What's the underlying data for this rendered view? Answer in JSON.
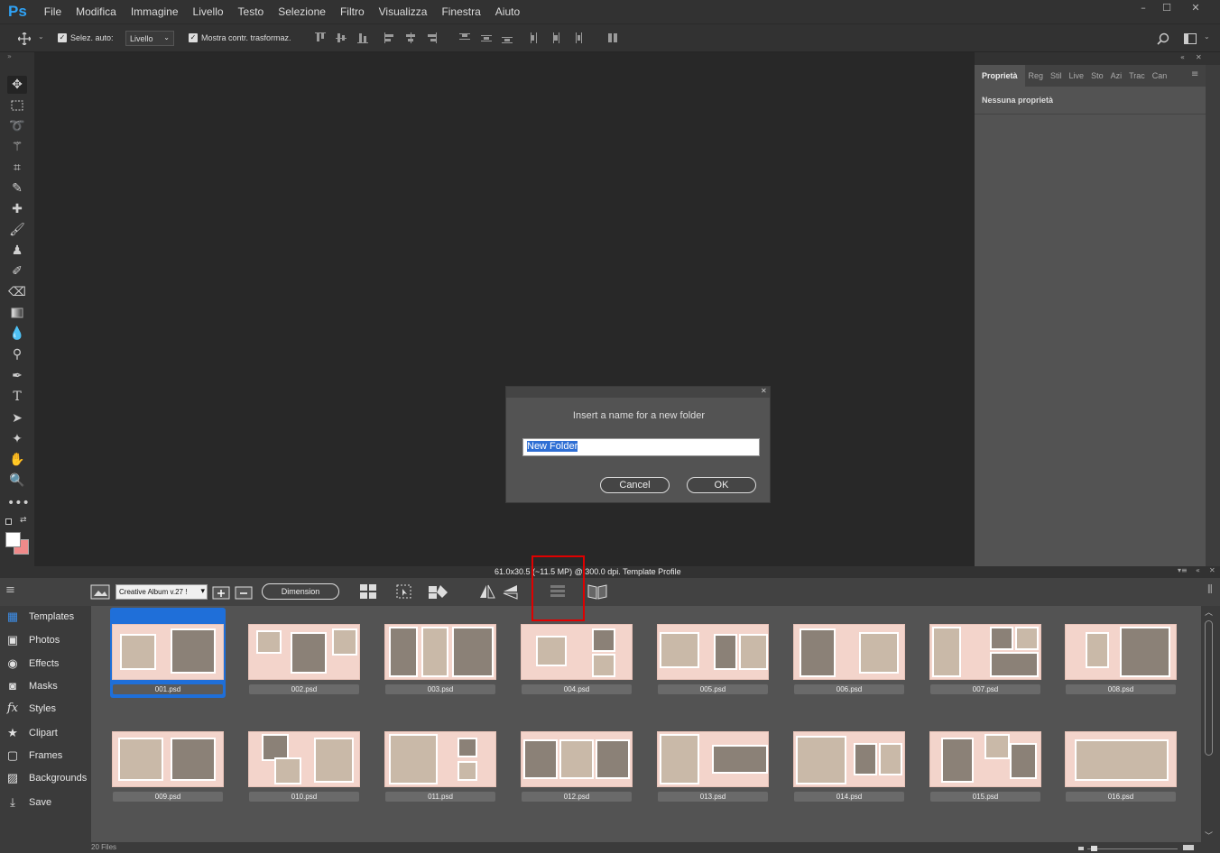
{
  "app": {
    "logo": "Ps"
  },
  "menu": [
    "File",
    "Modifica",
    "Immagine",
    "Livello",
    "Testo",
    "Selezione",
    "Filtro",
    "Visualizza",
    "Finestra",
    "Aiuto"
  ],
  "window_controls": {
    "minimize": "–",
    "maximize": "☐",
    "close": "✕"
  },
  "options_bar": {
    "auto_select_label": "Selez. auto:",
    "auto_select_value": "Livello",
    "show_transform_label": "Mostra contr. trasformaz."
  },
  "properties_panel": {
    "tabs": [
      "Proprietà",
      "Reg",
      "Stil",
      "Live",
      "Sto",
      "Azi",
      "Trac",
      "Can"
    ],
    "empty_text": "Nessuna proprietà"
  },
  "dialog": {
    "message": "Insert a name for a new folder",
    "input_value": "New Folder",
    "cancel_label": "Cancel",
    "ok_label": "OK"
  },
  "status_bar": {
    "text": "61.0x30.5 (~11.5 MP) @ 300.0 dpi.  Template Profile"
  },
  "plugin": {
    "album_select": "Creative Album v.27 !",
    "dimension_button": "Dimension",
    "nav": [
      {
        "label": "Templates",
        "icon": "grid-icon"
      },
      {
        "label": "Photos",
        "icon": "photo-icon"
      },
      {
        "label": "Effects",
        "icon": "effects-icon"
      },
      {
        "label": "Masks",
        "icon": "mask-icon"
      },
      {
        "label": "Styles",
        "icon": "fx-icon"
      },
      {
        "label": "Clipart",
        "icon": "star-icon"
      },
      {
        "label": "Frames",
        "icon": "frame-icon"
      },
      {
        "label": "Backgrounds",
        "icon": "landscape-icon"
      },
      {
        "label": "Save",
        "icon": "download-icon"
      }
    ],
    "files": [
      "001.psd",
      "002.psd",
      "003.psd",
      "004.psd",
      "005.psd",
      "006.psd",
      "007.psd",
      "008.psd",
      "009.psd",
      "010.psd",
      "011.psd",
      "012.psd",
      "013.psd",
      "014.psd",
      "015.psd",
      "016.psd"
    ],
    "file_count": "20 Files"
  },
  "colors": {
    "accent": "#1f6fd9",
    "highlight_box": "#e00000",
    "ps_blue": "#2fa3f6"
  }
}
